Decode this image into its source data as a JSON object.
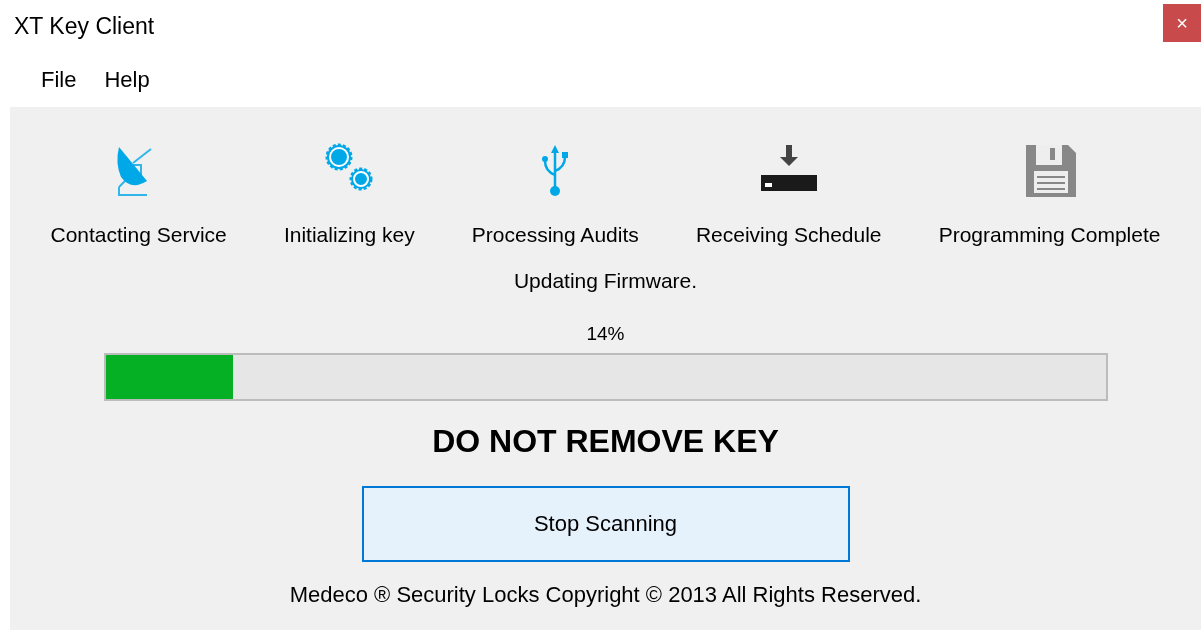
{
  "window": {
    "title": "XT Key Client",
    "close_label": "×"
  },
  "menu": [
    "File",
    "Help"
  ],
  "steps": [
    {
      "kind": "dish",
      "label": "Contacting Service",
      "active": true
    },
    {
      "kind": "gears",
      "label": "Initializing key",
      "active": true
    },
    {
      "kind": "usb",
      "label": "Processing Audits",
      "active": true
    },
    {
      "kind": "download",
      "label": "Receiving Schedule",
      "active": false
    },
    {
      "kind": "floppy",
      "label": "Programming Complete",
      "active": false
    }
  ],
  "status": "Updating Firmware.",
  "progress": {
    "reading": "14%",
    "level": 0.127
  },
  "warning": "DO NOT REMOVE KEY",
  "button": "Stop Scanning",
  "footer": "Medeco ® Security Locks Copyright © 2013 All Rights Reserved."
}
